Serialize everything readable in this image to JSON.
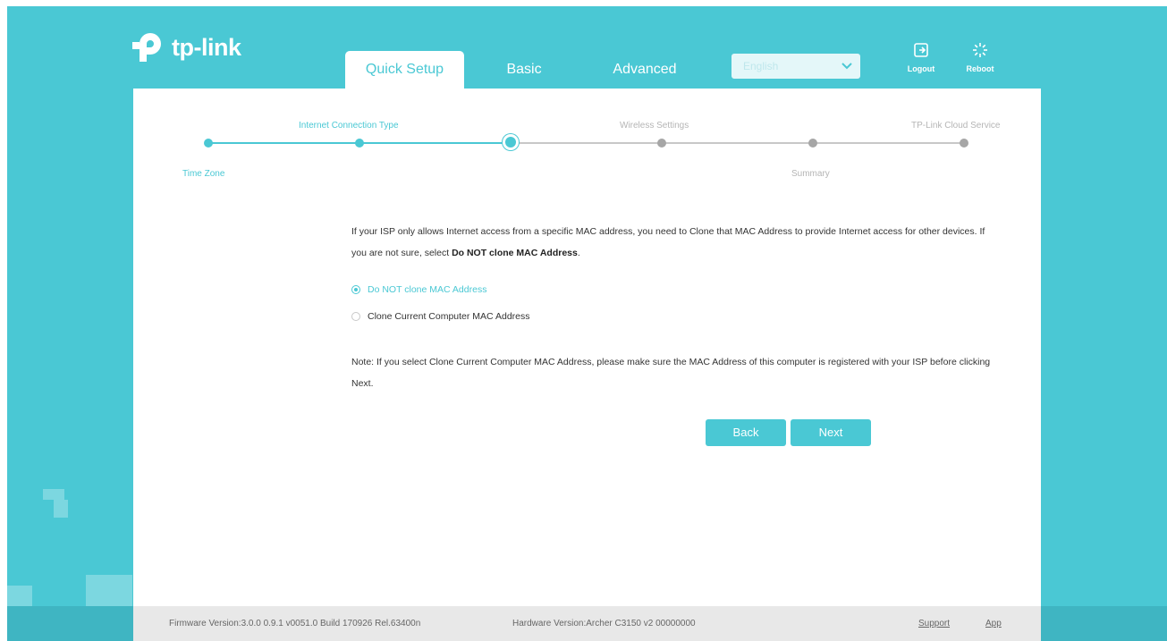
{
  "brand": {
    "logo_text": "tp-link"
  },
  "tabs": [
    {
      "label": "Quick Setup",
      "active": true
    },
    {
      "label": "Basic",
      "active": false
    },
    {
      "label": "Advanced",
      "active": false
    }
  ],
  "language": {
    "selected": "English"
  },
  "header_buttons": {
    "logout": "Logout",
    "reboot": "Reboot"
  },
  "stepper": {
    "top_labels": [
      "Internet Connection Type",
      "Wireless Settings",
      "TP-Link Cloud Service"
    ],
    "bottom_labels": [
      "Time Zone",
      "Summary"
    ],
    "current_step": 3,
    "total_steps": 6
  },
  "content": {
    "intro_text": "If your ISP only allows Internet access from a specific MAC address, you need to Clone that MAC Address to provide Internet access for other devices. If you are not sure, select ",
    "intro_bold": "Do NOT clone MAC Address",
    "intro_end": ".",
    "options": [
      {
        "label": "Do NOT clone MAC Address",
        "checked": true
      },
      {
        "label": "Clone Current Computer MAC Address",
        "checked": false
      }
    ],
    "note": "Note: If you select Clone Current Computer MAC Address, please make sure the MAC Address of this computer is registered with your ISP before clicking Next."
  },
  "buttons": {
    "back": "Back",
    "next": "Next"
  },
  "footer": {
    "firmware": "Firmware Version:3.0.0 0.9.1 v0051.0 Build 170926 Rel.63400n",
    "hardware": "Hardware Version:Archer C3150 v2 00000000",
    "support": "Support",
    "app": "App"
  },
  "colors": {
    "accent": "#4ac8d4",
    "panel": "#ffffff",
    "footer": "#e8e8e8"
  },
  "icons": {
    "logout": "logout-icon",
    "reboot": "reboot-icon",
    "dropdown": "chevron-down-icon"
  }
}
